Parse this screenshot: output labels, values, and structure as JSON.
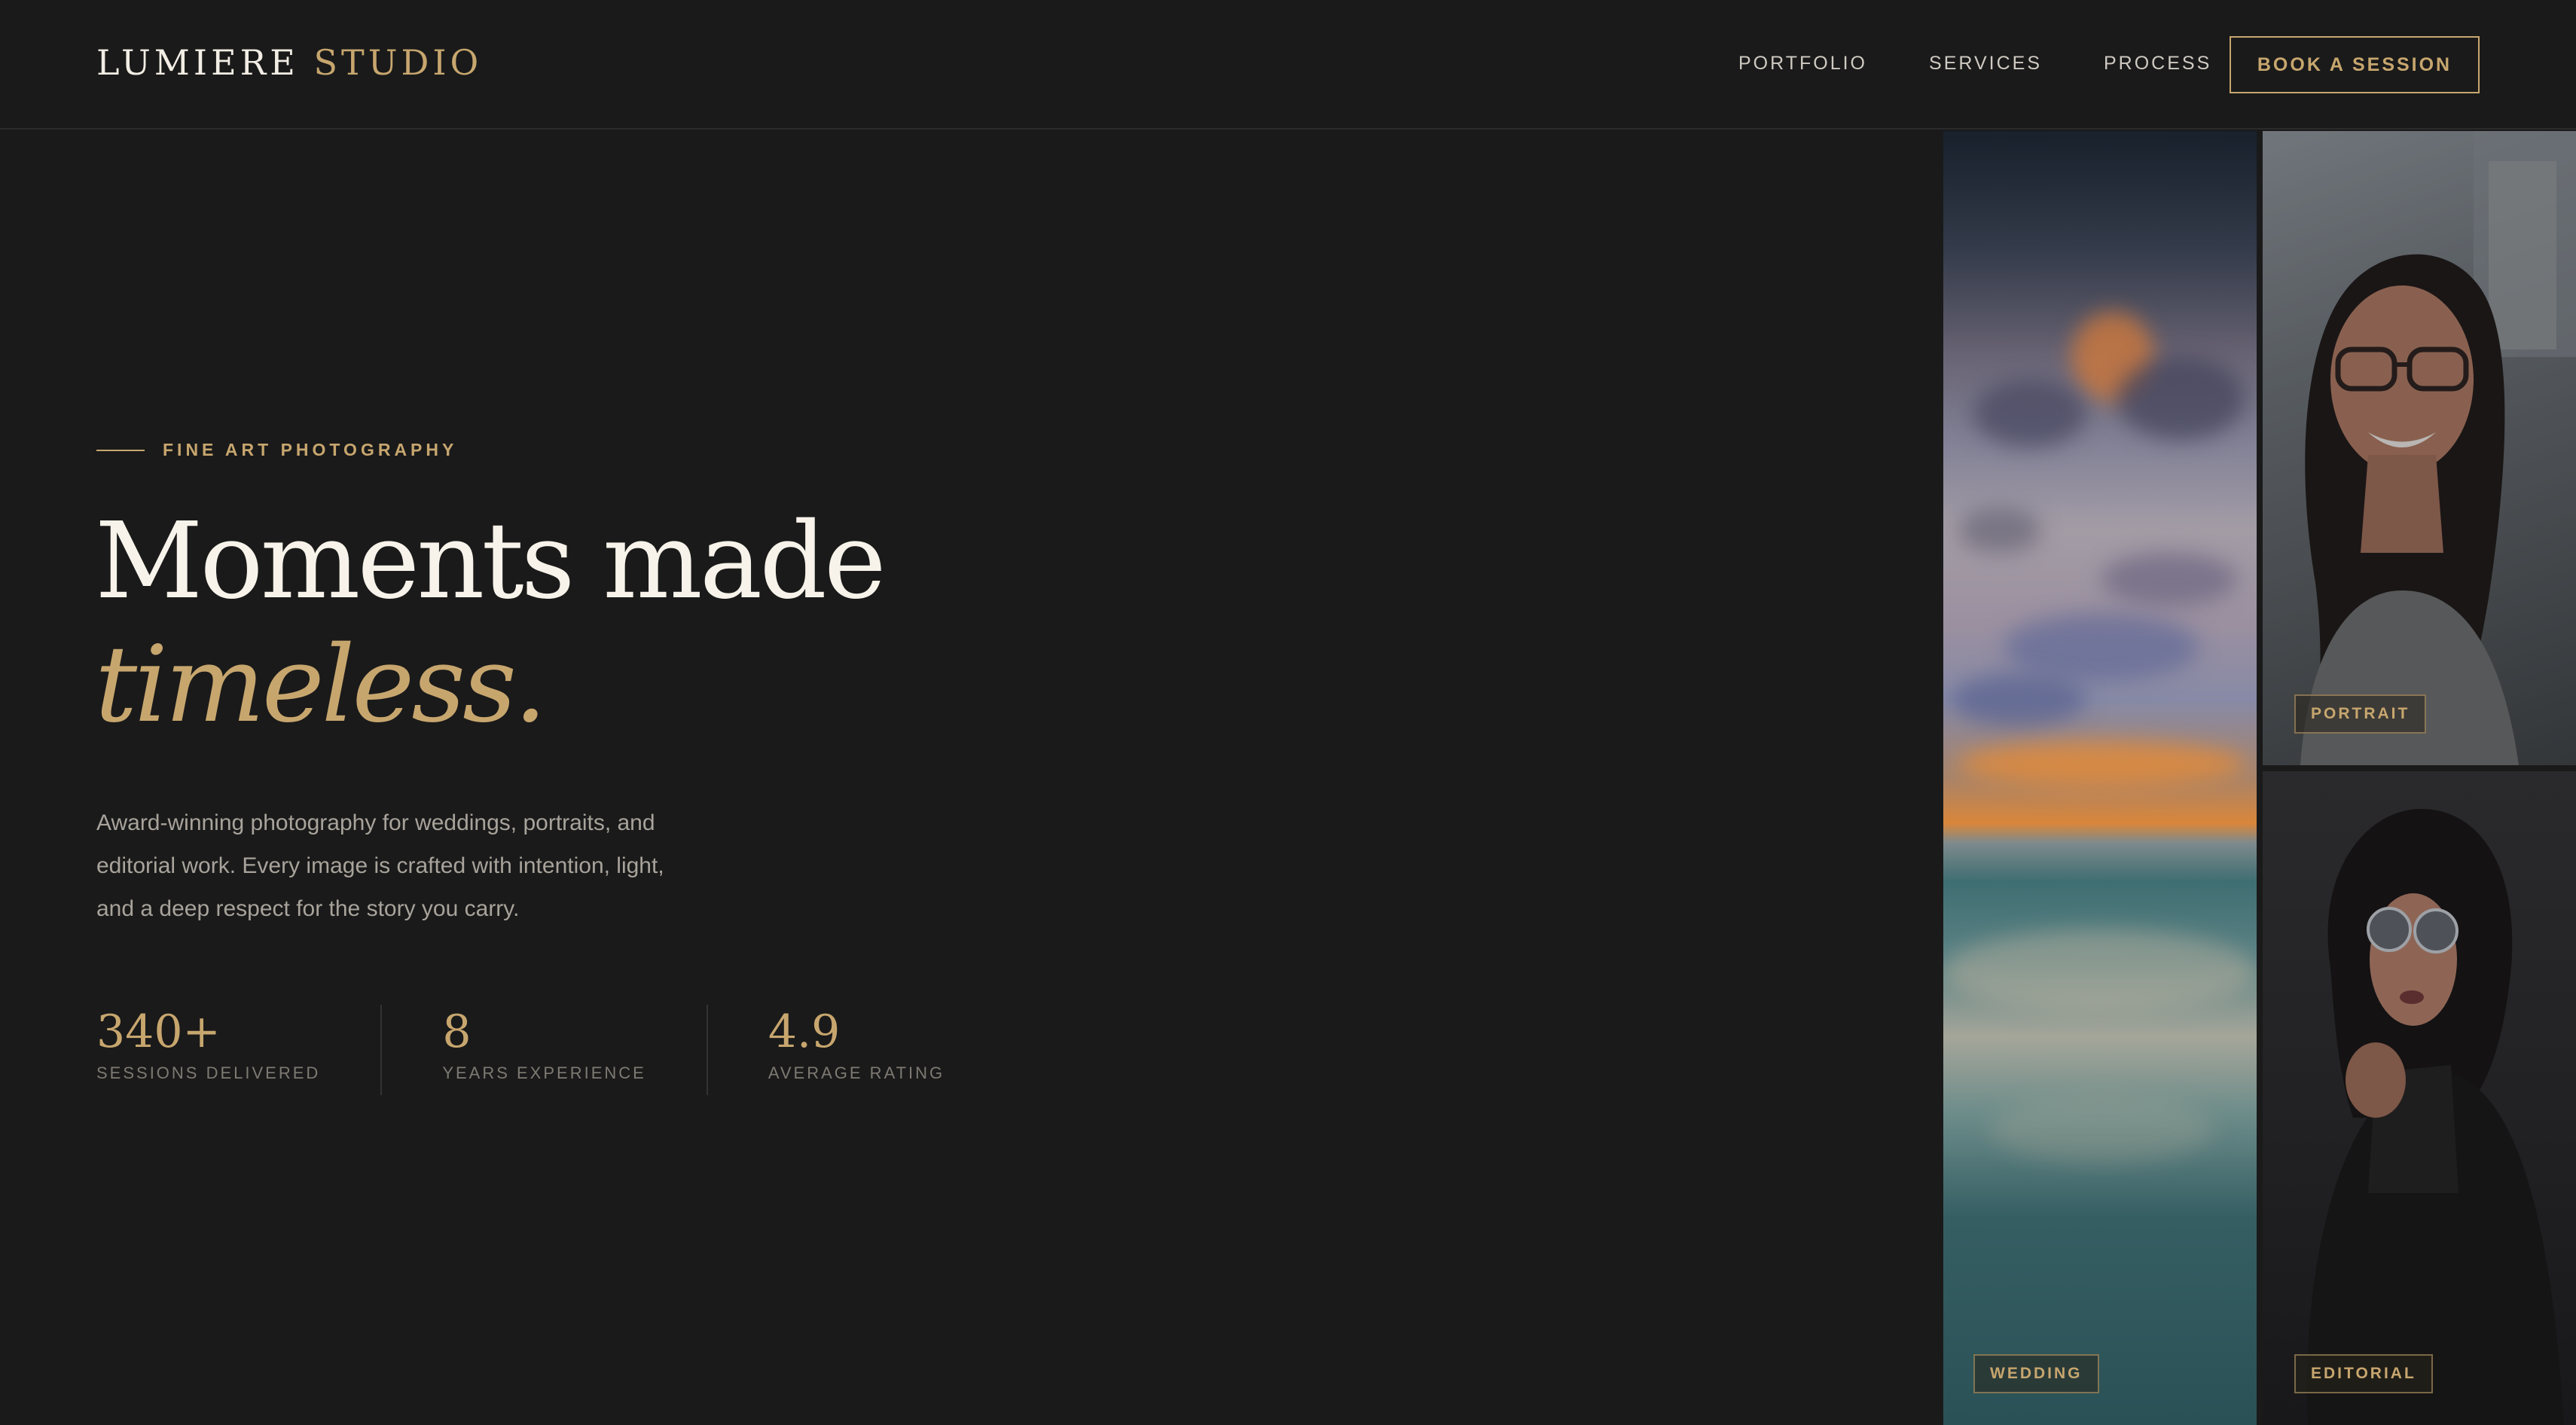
{
  "nav": {
    "brand_primary": "LUMIERE",
    "brand_accent": "STUDIO",
    "links": [
      "PORTFOLIO",
      "SERVICES",
      "PROCESS"
    ],
    "cta_label": "BOOK A SESSION"
  },
  "hero": {
    "eyebrow": "FINE ART PHOTOGRAPHY",
    "headline_line1": "Moments made",
    "headline_line2": "timeless.",
    "lede": "Award-winning photography for weddings, portraits, and editorial work. Every image is crafted with intention, light, and a deep respect for the story you carry.",
    "stats": [
      {
        "value": "340+",
        "label": "SESSIONS DELIVERED"
      },
      {
        "value": "8",
        "label": "YEARS EXPERIENCE"
      },
      {
        "value": "4.9",
        "label": "AVERAGE RATING"
      }
    ]
  },
  "gallery": {
    "tiles": [
      {
        "tag": "WEDDING",
        "image": "ocean-sunset-photo"
      },
      {
        "tag": "PORTRAIT",
        "image": "smiling-woman-glasses-photo"
      },
      {
        "tag": "EDITORIAL",
        "image": "woman-sunglasses-dark-jacket-photo"
      }
    ]
  },
  "colors": {
    "background": "#1a1a1a",
    "accent_gold": "#c7a66e",
    "text_primary": "#f2ede4",
    "text_muted": "#a8a39b"
  }
}
